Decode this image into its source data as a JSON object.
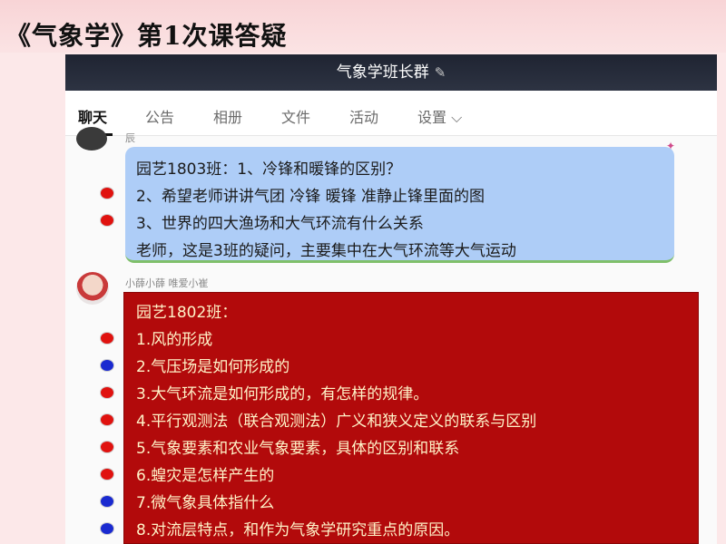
{
  "slide": {
    "title": "《气象学》第1次课答疑"
  },
  "app": {
    "group_name": "气象学班长群",
    "edit_icon": "✎",
    "tabs": [
      {
        "label": "聊天"
      },
      {
        "label": "公告"
      },
      {
        "label": "相册"
      },
      {
        "label": "文件"
      },
      {
        "label": "活动"
      },
      {
        "label": "设置 ⌵"
      }
    ]
  },
  "chat": {
    "messages": [
      {
        "sender": "辰",
        "style": "blue-bubble",
        "lines": [
          "园艺1803班：1、冷锋和暖锋的区别？",
          "2、希望老师讲讲气团 冷锋 暖锋 准静止锋里面的图",
          "3、世界的四大渔场和大气环流有什么关系",
          "老师，这是3班的疑问，主要集中在大气环流等大气运动"
        ],
        "markers": [
          "red",
          "red"
        ]
      },
      {
        "sender": "小薛小薛 唯爱小崔",
        "style": "red-bubble",
        "lines": [
          "园艺1802班：",
          "1.风的形成",
          "2.气压场是如何形成的",
          "3.大气环流是如何形成的，有怎样的规律。",
          "4.平行观测法（联合观测法）广义和狭义定义的联系与区别",
          "5.气象要素和农业气象要素，具体的区别和联系",
          "6.蝗灾是怎样产生的",
          "7.微气象具体指什么",
          "8.对流层特点，和作为气象学研究重点的原因。"
        ],
        "markers": [
          "red",
          "blue",
          "red",
          "red",
          "red",
          "red",
          "blue",
          "blue"
        ]
      }
    ]
  },
  "colors": {
    "marker_red": "#e0120f",
    "marker_blue": "#1a2ad0",
    "bubble_blue": "#aecdf7",
    "bubble_red": "#b20a0b"
  }
}
